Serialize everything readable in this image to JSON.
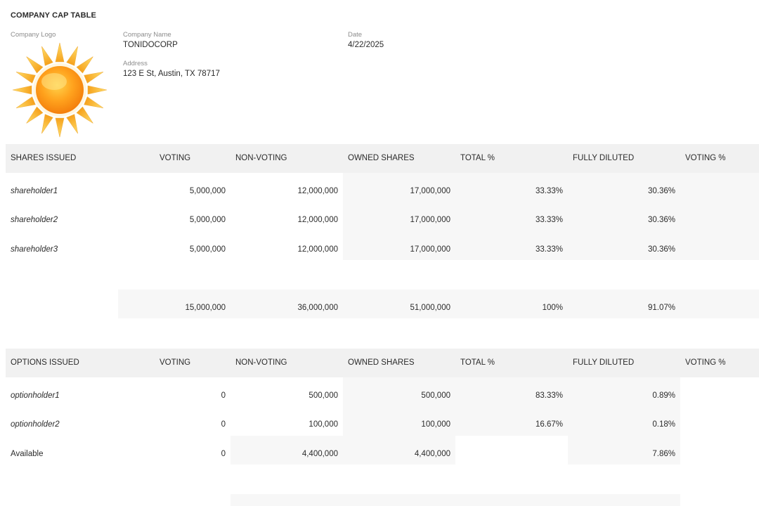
{
  "header": {
    "title": "COMPANY CAP TABLE",
    "logo_label": "Company Logo",
    "logo_icon": "sun-icon",
    "company_name_label": "Company Name",
    "company_name": "TONIDOCORP",
    "address_label": "Address",
    "address": "123 E St, Austin, TX 78717",
    "date_label": "Date",
    "date": "4/22/2025"
  },
  "shares": {
    "columns": [
      "SHARES ISSUED",
      "VOTING",
      "NON-VOTING",
      "OWNED SHARES",
      "TOTAL %",
      "FULLY DILUTED",
      "VOTING %"
    ],
    "rows": [
      {
        "name": "shareholder1",
        "voting": "5,000,000",
        "non_voting": "12,000,000",
        "owned": "17,000,000",
        "total_pct": "33.33%",
        "fully_diluted": "30.36%"
      },
      {
        "name": "shareholder2",
        "voting": "5,000,000",
        "non_voting": "12,000,000",
        "owned": "17,000,000",
        "total_pct": "33.33%",
        "fully_diluted": "30.36%"
      },
      {
        "name": "shareholder3",
        "voting": "5,000,000",
        "non_voting": "12,000,000",
        "owned": "17,000,000",
        "total_pct": "33.33%",
        "fully_diluted": "30.36%"
      }
    ],
    "totals": {
      "voting": "15,000,000",
      "non_voting": "36,000,000",
      "owned": "51,000,000",
      "total_pct": "100%",
      "fully_diluted": "91.07%"
    }
  },
  "options": {
    "columns": [
      "OPTIONS ISSUED",
      "VOTING",
      "NON-VOTING",
      "OWNED SHARES",
      "TOTAL %",
      "FULLY DILUTED",
      "VOTING %"
    ],
    "rows": [
      {
        "name": "optionholder1",
        "voting": "0",
        "non_voting": "500,000",
        "owned": "500,000",
        "total_pct": "83.33%",
        "fully_diluted": "0.89%"
      },
      {
        "name": "optionholder2",
        "voting": "0",
        "non_voting": "100,000",
        "owned": "100,000",
        "total_pct": "16.67%",
        "fully_diluted": "0.18%"
      }
    ],
    "available": {
      "name": "Available",
      "voting": "0",
      "non_voting": "4,400,000",
      "owned": "4,400,000",
      "total_pct": "",
      "fully_diluted": "7.86%"
    }
  }
}
